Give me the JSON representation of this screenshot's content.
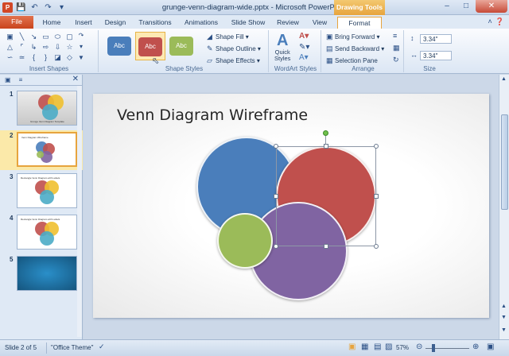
{
  "window": {
    "title": "grunge-venn-diagram-wide.pptx - Microsoft PowerPoint",
    "context_tab": "Drawing Tools",
    "app_icon": "P"
  },
  "tabs": [
    "File",
    "Home",
    "Insert",
    "Design",
    "Transitions",
    "Animations",
    "Slide Show",
    "Review",
    "View",
    "Format"
  ],
  "ribbon": {
    "insert_shapes_label": "Insert Shapes",
    "shape_styles_label": "Shape Styles",
    "abc": [
      "Abc",
      "Abc",
      "Abc"
    ],
    "shape_fill": "Shape Fill",
    "shape_outline": "Shape Outline",
    "shape_effects": "Shape Effects",
    "quick_styles": "Quick\nStyles",
    "wordart_label": "WordArt Styles",
    "bring_forward": "Bring Forward",
    "send_backward": "Send Backward",
    "selection_pane": "Selection Pane",
    "arrange_label": "Arrange",
    "height": "3.34\"",
    "width": "3.34\"",
    "size_label": "Size"
  },
  "thumbnails": [
    {
      "num": "1",
      "title": "Grunge Venn Diagram Template"
    },
    {
      "num": "2",
      "title": "Venn Diagram Wireframe"
    },
    {
      "num": "3",
      "title": "Rectangle Venn Diagram with Labels"
    },
    {
      "num": "4",
      "title": "Rectangle Venn Diagram with Labels"
    },
    {
      "num": "5",
      "title": ""
    }
  ],
  "slide": {
    "title": "Venn Diagram Wireframe"
  },
  "colors": {
    "blue": "#4a7ebb",
    "red": "#c0504d",
    "green": "#9bbb59",
    "purple": "#8064a2",
    "accent": "#e7a43e"
  },
  "status": {
    "slide": "Slide 2 of 5",
    "theme": "\"Office Theme\"",
    "zoom": "57%"
  }
}
